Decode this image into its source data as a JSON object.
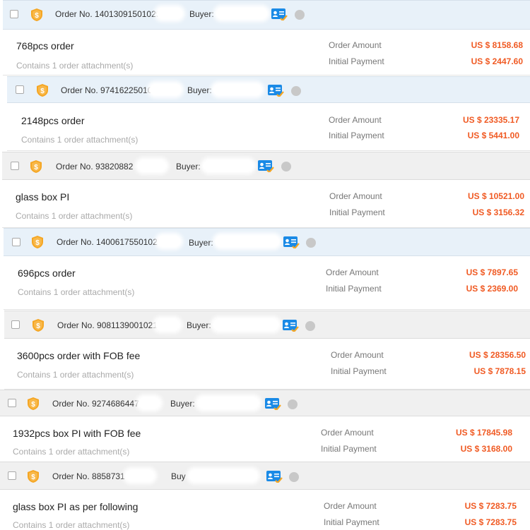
{
  "labels": {
    "order_amount": "Order Amount",
    "initial_payment": "Initial Payment",
    "buyer": "Buyer:",
    "buyer_short": "Buy",
    "attachment": "Contains 1 order attachment(s)"
  },
  "orders": [
    {
      "order_no": "Order No. 14013091501029",
      "title": "768pcs order",
      "order_amount": "US $ 8158.68",
      "initial_payment": "US $ 2447.60"
    },
    {
      "order_no": "Order No. 97416225010",
      "title": "2148pcs order",
      "order_amount": "US $ 23335.17",
      "initial_payment": "US $ 5441.00"
    },
    {
      "order_no": "Order No. 93820882",
      "title": "glass box PI",
      "order_amount": "US $ 10521.00",
      "initial_payment": "US $ 3156.32"
    },
    {
      "order_no": "Order No. 14006175501027",
      "title": "696pcs order",
      "order_amount": "US $ 7897.65",
      "initial_payment": "US $ 2369.00"
    },
    {
      "order_no": "Order No. 90811390010213",
      "title": "3600pcs order with FOB fee",
      "order_amount": "US $ 28356.50",
      "initial_payment": "US $ 7878.15"
    },
    {
      "order_no": "Order No. 9274686447",
      "title": "1932pcs box PI with FOB fee",
      "order_amount": "US $ 17845.98",
      "initial_payment": "US $ 3168.00"
    },
    {
      "order_no": "Order No. 8858731",
      "title": "glass box PI as per following",
      "order_amount": "US $ 7283.75",
      "initial_payment": "US $ 7283.75"
    }
  ],
  "colors": {
    "header_blue": "#e8f1f9",
    "header_gray": "#f0f0f0",
    "amount": "#f05a23",
    "shield": "#f5a623",
    "card": "#1a8ae6"
  },
  "icons": [
    "checkbox",
    "gold-shield-icon",
    "buyer-card-icon",
    "chat-status-icon"
  ]
}
